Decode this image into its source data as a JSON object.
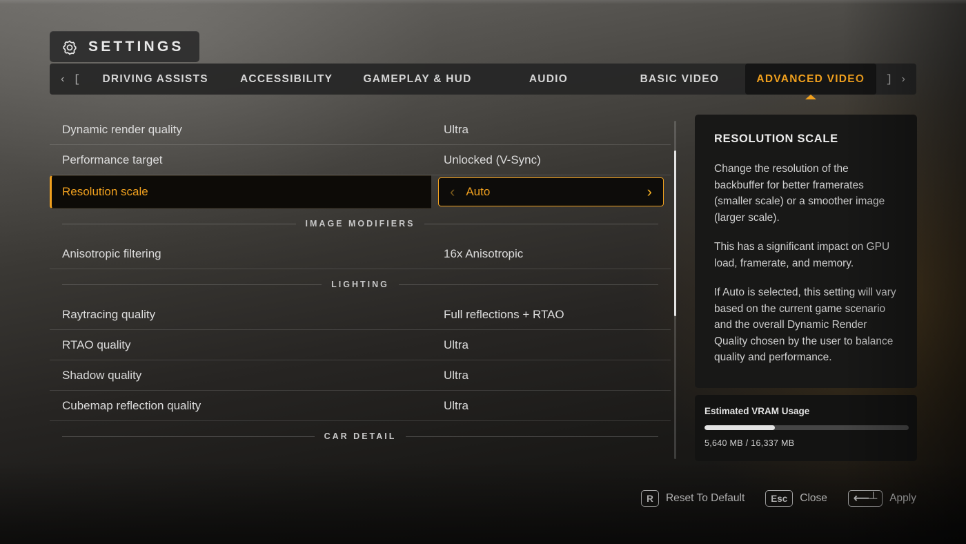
{
  "header": {
    "title": "SETTINGS",
    "gear_icon": "gear-icon"
  },
  "tabbar": {
    "prev_chevron": "‹",
    "prev_bracket": "[",
    "next_bracket": "]",
    "next_chevron": "›",
    "tabs": [
      {
        "label": "DRIVING ASSISTS",
        "active": false
      },
      {
        "label": "ACCESSIBILITY",
        "active": false
      },
      {
        "label": "GAMEPLAY & HUD",
        "active": false
      },
      {
        "label": "AUDIO",
        "active": false
      },
      {
        "label": "BASIC VIDEO",
        "active": false
      },
      {
        "label": "ADVANCED VIDEO",
        "active": true
      }
    ]
  },
  "settings": {
    "rows": [
      {
        "type": "row",
        "label": "Dynamic render quality",
        "value": "Ultra"
      },
      {
        "type": "row",
        "label": "Performance target",
        "value": "Unlocked (V-Sync)"
      },
      {
        "type": "selected",
        "label": "Resolution scale",
        "value": "Auto",
        "left_arrow": "‹",
        "right_arrow": "›"
      },
      {
        "type": "section",
        "label": "IMAGE MODIFIERS"
      },
      {
        "type": "row",
        "label": "Anisotropic filtering",
        "value": "16x Anisotropic"
      },
      {
        "type": "section",
        "label": "LIGHTING"
      },
      {
        "type": "row",
        "label": "Raytracing quality",
        "value": "Full reflections + RTAO"
      },
      {
        "type": "row",
        "label": "RTAO quality",
        "value": "Ultra"
      },
      {
        "type": "row",
        "label": "Shadow quality",
        "value": "Ultra"
      },
      {
        "type": "row",
        "label": "Cubemap reflection quality",
        "value": "Ultra"
      },
      {
        "type": "section",
        "label": "CAR DETAIL"
      }
    ]
  },
  "info_panel": {
    "title": "RESOLUTION SCALE",
    "paragraphs": [
      "Change the resolution of the backbuffer for better framerates (smaller scale) or a smoother image (larger scale).",
      "This has a significant impact on GPU load, framerate, and memory.",
      "If Auto is selected, this setting will vary based on the current game scenario and the overall Dynamic Render Quality chosen by the user to balance quality and performance."
    ]
  },
  "vram": {
    "title": "Estimated VRAM Usage",
    "used_mb": "5,640 MB",
    "total_mb": "16,337 MB",
    "readout": "5,640 MB / 16,337 MB",
    "percent": 34.5
  },
  "footer": {
    "actions": [
      {
        "key": "R",
        "label": "Reset To Default",
        "wide": false
      },
      {
        "key": "Esc",
        "label": "Close",
        "wide": false
      },
      {
        "key": "⟵┴",
        "label": "Apply",
        "wide": true
      }
    ]
  },
  "colors": {
    "accent": "#f0a01e",
    "text_primary": "#dcdcdc",
    "panel_bg": "#181817"
  }
}
